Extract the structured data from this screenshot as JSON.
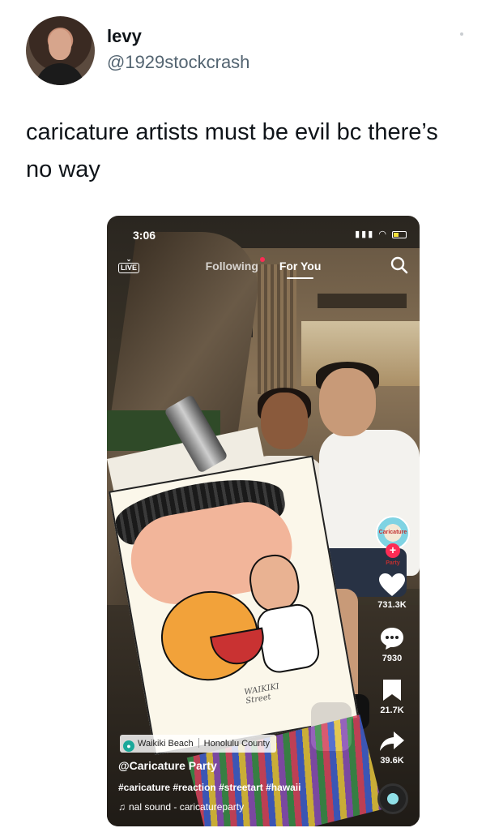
{
  "tweet": {
    "display_name": "levy",
    "handle": "@1929stockcrash",
    "text": "caricature artists must be evil bc there’s no way"
  },
  "tiktok": {
    "status": {
      "time": "3:06"
    },
    "live_label": "LIVE",
    "tabs": {
      "following": "Following",
      "for_you": "For You"
    },
    "creator_avatar_text": "Caricature Party",
    "actions": {
      "likes": "731.3K",
      "comments": "7930",
      "saves": "21.7K",
      "shares": "39.6K"
    },
    "location": {
      "place": "Waikiki Beach",
      "county": "Honolulu County"
    },
    "author": "@Caricature Party",
    "hashtags": "#caricature #reaction #streetart #hawaii",
    "sound": "nal sound - caricatureparty",
    "drawing_signature": "WAIKIKI\nStreet"
  },
  "colors": {
    "tiktok_red": "#fe2c55",
    "text_primary": "#0f1419",
    "text_secondary": "#536471",
    "location_pin": "#1aa89a"
  },
  "icons": [
    "live-icon",
    "search-icon",
    "heart-icon",
    "comment-icon",
    "bookmark-icon",
    "share-icon",
    "music-note-icon",
    "location-pin-icon",
    "signal-icon",
    "wifi-icon",
    "battery-icon"
  ]
}
